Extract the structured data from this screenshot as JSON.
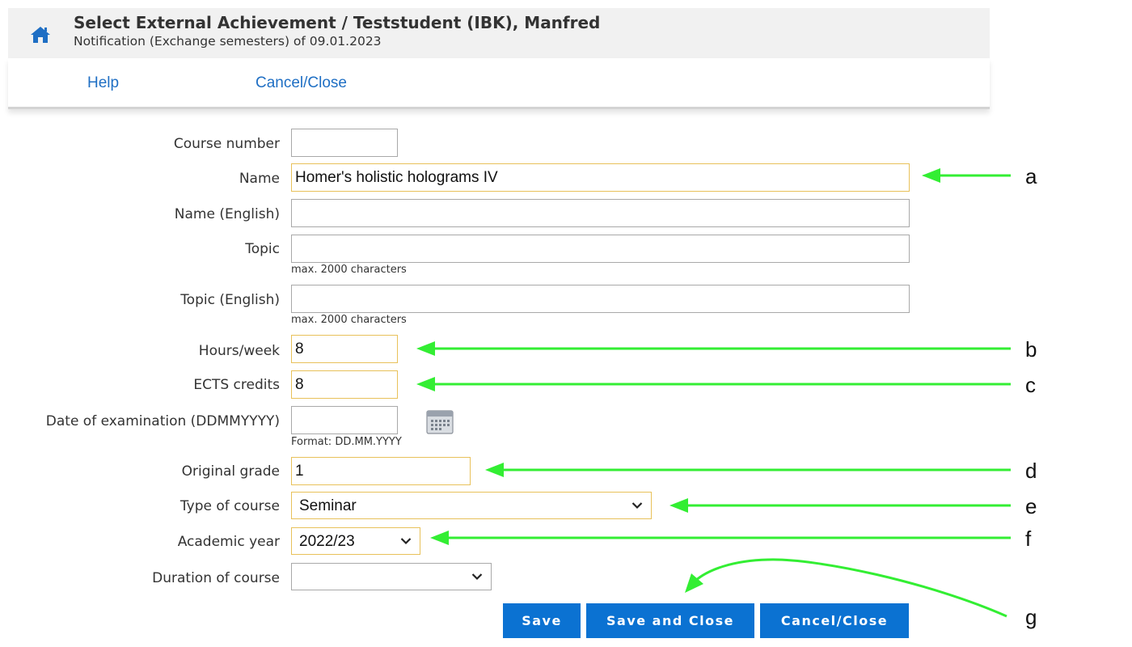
{
  "header": {
    "title": "Select External Achievement  / Teststudent (IBK), Manfred",
    "subtitle": "Notification (Exchange semesters) of 09.01.2023"
  },
  "menu": {
    "help": "Help",
    "cancel_close": "Cancel/Close"
  },
  "form": {
    "course_number": {
      "label": "Course number",
      "value": ""
    },
    "name": {
      "label": "Name",
      "value": "Homer's holistic holograms IV"
    },
    "name_english": {
      "label": "Name (English)",
      "value": ""
    },
    "topic": {
      "label": "Topic",
      "value": "",
      "hint": "max. 2000 characters"
    },
    "topic_english": {
      "label": "Topic (English)",
      "value": "",
      "hint": "max. 2000 characters"
    },
    "hours_week": {
      "label": "Hours/week",
      "value": "8"
    },
    "ects_credits": {
      "label": "ECTS credits",
      "value": "8"
    },
    "date_of_examination": {
      "label": "Date of examination (DDMMYYYY)",
      "value": "",
      "hint": "Format: DD.MM.YYYY"
    },
    "original_grade": {
      "label": "Original grade",
      "value": "1"
    },
    "type_of_course": {
      "label": "Type of course",
      "value": "Seminar"
    },
    "academic_year": {
      "label": "Academic year",
      "value": "2022/23"
    },
    "duration_of_course": {
      "label": "Duration of course",
      "value": ""
    }
  },
  "buttons": {
    "save": "Save",
    "save_and_close": "Save and Close",
    "cancel_close": "Cancel/Close"
  },
  "annotations": {
    "a": "a",
    "b": "b",
    "c": "c",
    "d": "d",
    "e": "e",
    "f": "f",
    "g": "g"
  },
  "colors": {
    "accent": "#0b72d2",
    "link": "#1f6fc4",
    "required_border": "#e8c15a",
    "annotation_arrow": "#33ee33"
  },
  "icons": {
    "home": "home-icon",
    "calendar": "calendar-icon",
    "dropdown": "chevron-down-icon"
  }
}
